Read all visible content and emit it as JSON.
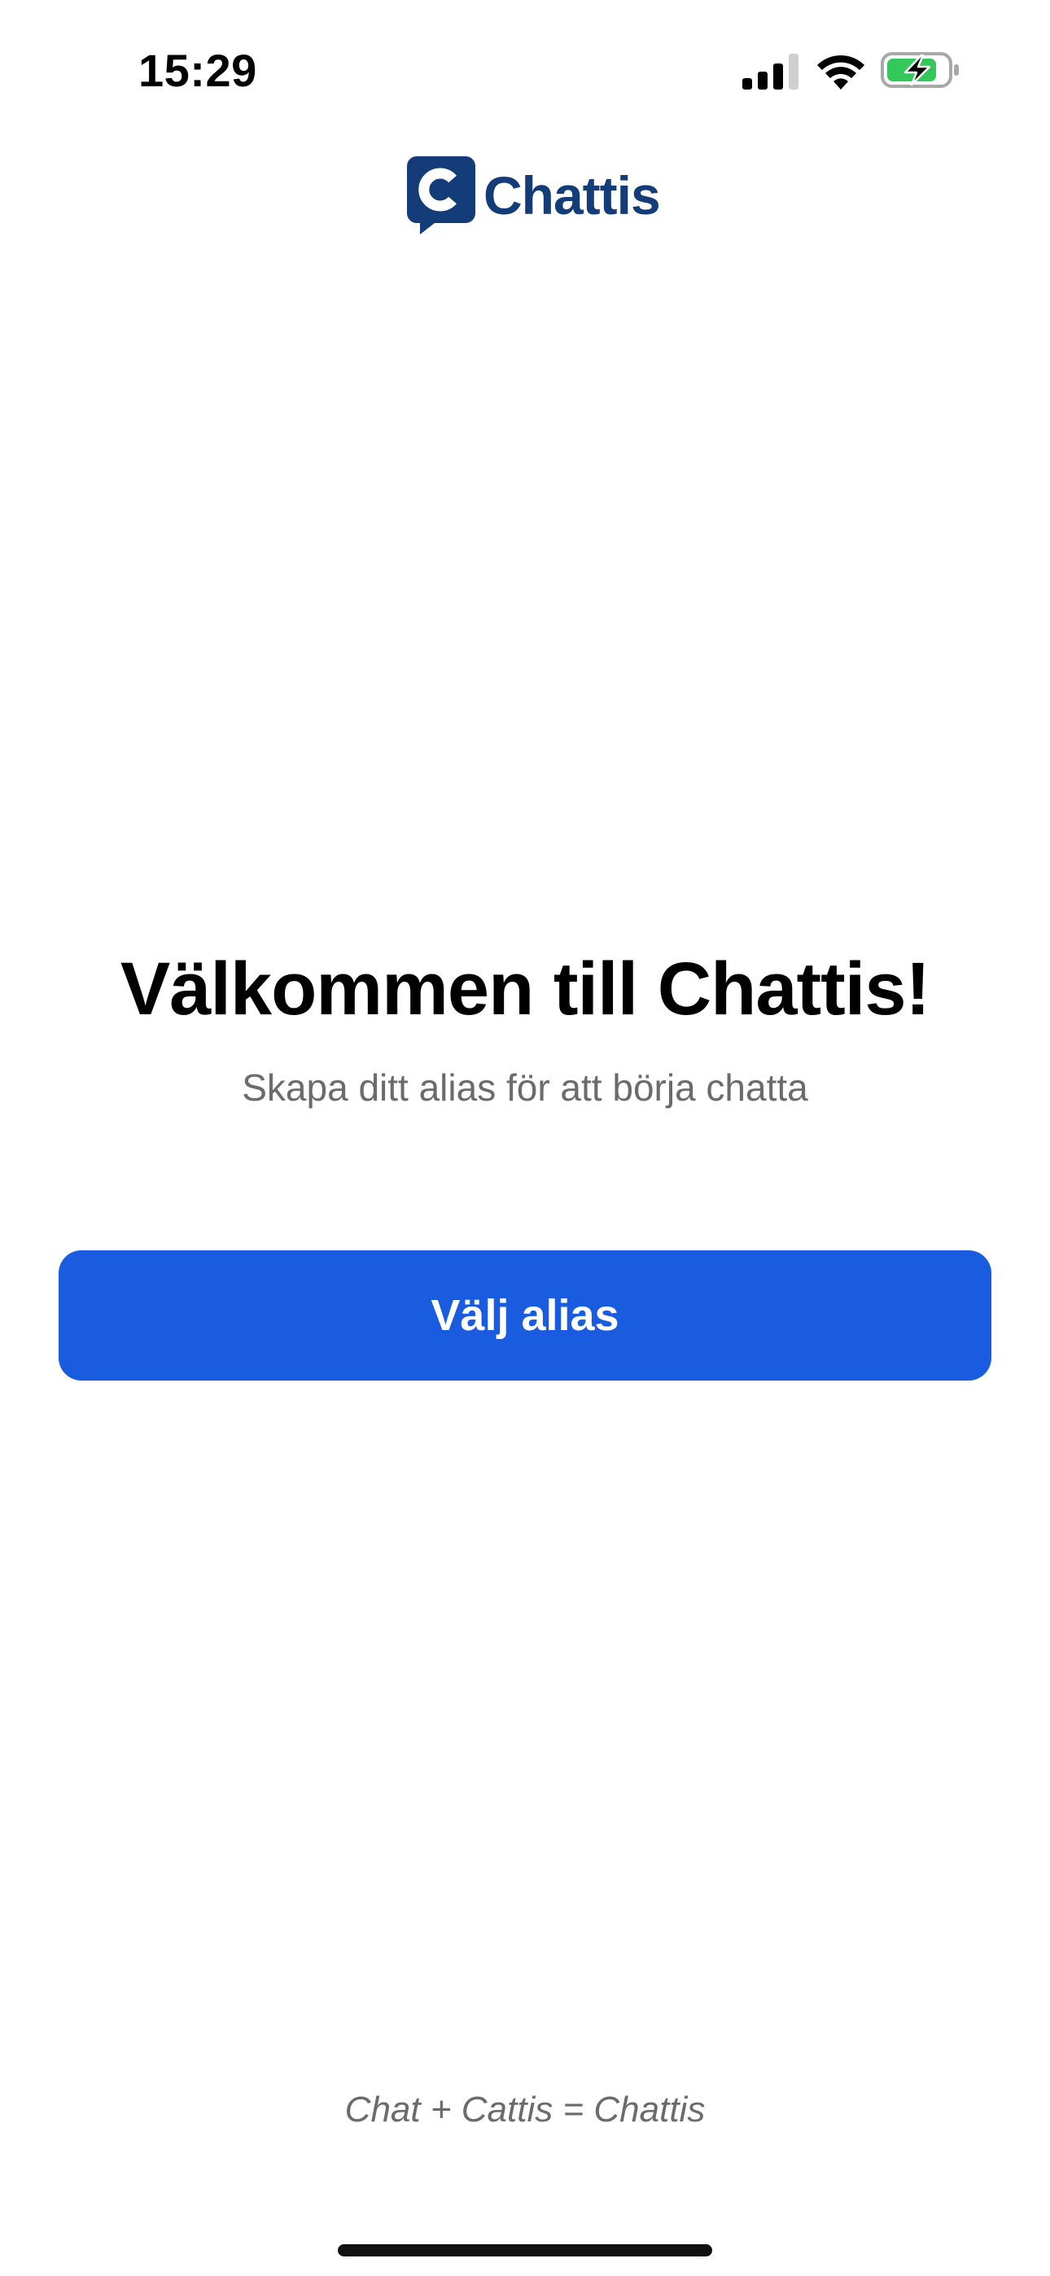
{
  "status_bar": {
    "time": "15:29",
    "signal_icon": "cellular-signal-icon",
    "wifi_icon": "wifi-icon",
    "battery_icon": "battery-charging-icon",
    "battery_color": "#34c759"
  },
  "logo": {
    "mark_letter": "C",
    "name": "Chattis",
    "color": "#143c78"
  },
  "welcome": {
    "title": "Välkommen till Chattis!",
    "subtitle": "Skapa ditt alias för att börja chatta"
  },
  "actions": {
    "choose_alias_label": "Välj alias",
    "button_color": "#1a5ce0"
  },
  "footer": {
    "tagline": "Chat + Cattis = Chattis"
  }
}
